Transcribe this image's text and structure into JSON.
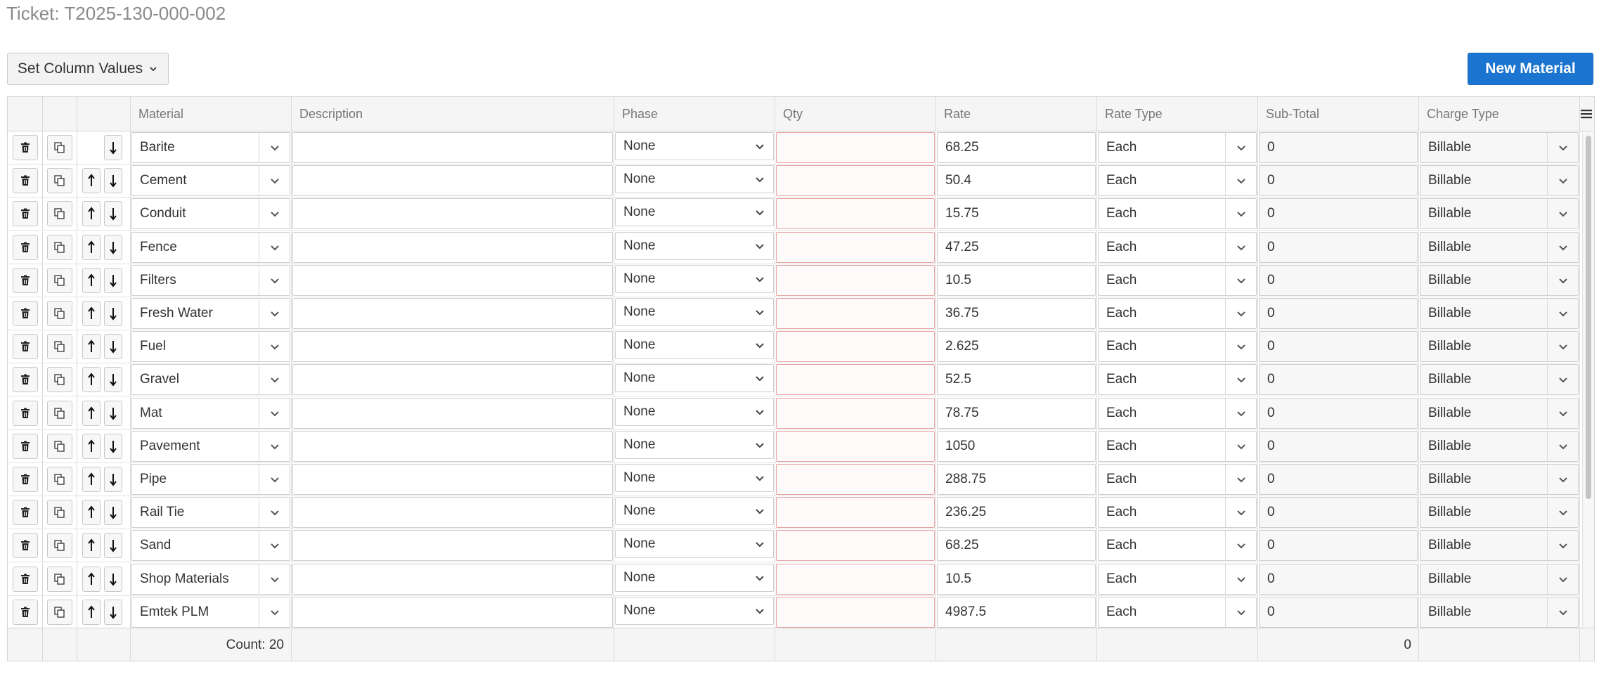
{
  "ticket": {
    "title": "Ticket: T2025-130-000-002"
  },
  "toolbar": {
    "set_column_values": "Set Column Values",
    "new_material": "New Material"
  },
  "columns": [
    "",
    "",
    "",
    "Material",
    "Description",
    "Phase",
    "Qty",
    "Rate",
    "Rate Type",
    "Sub-Total",
    "Charge Type"
  ],
  "rows": [
    {
      "material": "Barite",
      "description": "",
      "phase": "None",
      "qty": "",
      "rate": "68.25",
      "rate_type": "Each",
      "subtotal": "0",
      "charge_type": "Billable",
      "first": true
    },
    {
      "material": "Cement",
      "description": "",
      "phase": "None",
      "qty": "",
      "rate": "50.4",
      "rate_type": "Each",
      "subtotal": "0",
      "charge_type": "Billable"
    },
    {
      "material": "Conduit",
      "description": "",
      "phase": "None",
      "qty": "",
      "rate": "15.75",
      "rate_type": "Each",
      "subtotal": "0",
      "charge_type": "Billable"
    },
    {
      "material": "Fence",
      "description": "",
      "phase": "None",
      "qty": "",
      "rate": "47.25",
      "rate_type": "Each",
      "subtotal": "0",
      "charge_type": "Billable"
    },
    {
      "material": "Filters",
      "description": "",
      "phase": "None",
      "qty": "",
      "rate": "10.5",
      "rate_type": "Each",
      "subtotal": "0",
      "charge_type": "Billable"
    },
    {
      "material": "Fresh Water",
      "description": "",
      "phase": "None",
      "qty": "",
      "rate": "36.75",
      "rate_type": "Each",
      "subtotal": "0",
      "charge_type": "Billable"
    },
    {
      "material": "Fuel",
      "description": "",
      "phase": "None",
      "qty": "",
      "rate": "2.625",
      "rate_type": "Each",
      "subtotal": "0",
      "charge_type": "Billable"
    },
    {
      "material": "Gravel",
      "description": "",
      "phase": "None",
      "qty": "",
      "rate": "52.5",
      "rate_type": "Each",
      "subtotal": "0",
      "charge_type": "Billable"
    },
    {
      "material": "Mat",
      "description": "",
      "phase": "None",
      "qty": "",
      "rate": "78.75",
      "rate_type": "Each",
      "subtotal": "0",
      "charge_type": "Billable"
    },
    {
      "material": "Pavement",
      "description": "",
      "phase": "None",
      "qty": "",
      "rate": "1050",
      "rate_type": "Each",
      "subtotal": "0",
      "charge_type": "Billable"
    },
    {
      "material": "Pipe",
      "description": "",
      "phase": "None",
      "qty": "",
      "rate": "288.75",
      "rate_type": "Each",
      "subtotal": "0",
      "charge_type": "Billable"
    },
    {
      "material": "Rail Tie",
      "description": "",
      "phase": "None",
      "qty": "",
      "rate": "236.25",
      "rate_type": "Each",
      "subtotal": "0",
      "charge_type": "Billable"
    },
    {
      "material": "Sand",
      "description": "",
      "phase": "None",
      "qty": "",
      "rate": "68.25",
      "rate_type": "Each",
      "subtotal": "0",
      "charge_type": "Billable"
    },
    {
      "material": "Shop Materials",
      "description": "",
      "phase": "None",
      "qty": "",
      "rate": "10.5",
      "rate_type": "Each",
      "subtotal": "0",
      "charge_type": "Billable"
    },
    {
      "material": "Emtek PLM",
      "description": "",
      "phase": "None",
      "qty": "",
      "rate": "4987.5",
      "rate_type": "Each",
      "subtotal": "0",
      "charge_type": "Billable"
    }
  ],
  "footer": {
    "count": "Count: 20",
    "subtotal_total": "0"
  },
  "icons": {
    "delete": "trash-icon",
    "copy": "copy-icon",
    "up": "arrow-up-icon",
    "down": "arrow-down-icon",
    "dropdown": "chevron-down-icon",
    "menu": "hamburger-menu-icon"
  }
}
